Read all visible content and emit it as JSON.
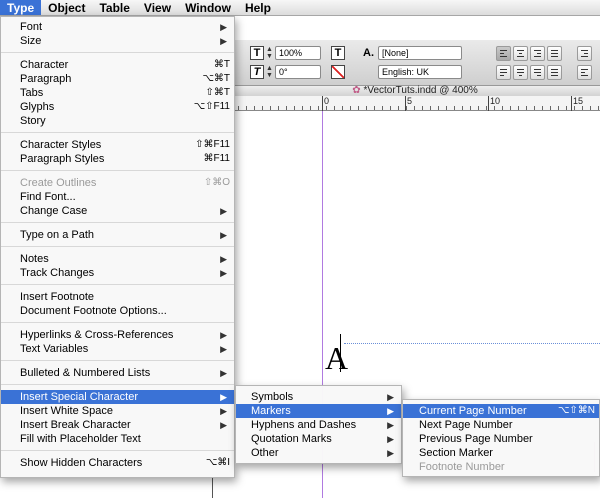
{
  "menubar": {
    "items": [
      "Type",
      "Object",
      "Table",
      "View",
      "Window",
      "Help"
    ],
    "active": "Type"
  },
  "control_panel": {
    "tracking_value": "100%",
    "skew_value": "0°",
    "char_style_value": "[None]",
    "language_value": "English: UK",
    "icon_t": "T",
    "icon_a": "A."
  },
  "document": {
    "title": "*VectorTuts.indd @ 400%",
    "ruler_numbers": [
      "0",
      "5",
      "10",
      "15"
    ],
    "text_glyph": "A"
  },
  "type_menu": {
    "groups": [
      [
        {
          "label": "Font",
          "shortcut": "",
          "submenu": true
        },
        {
          "label": "Size",
          "shortcut": "",
          "submenu": true
        }
      ],
      [
        {
          "label": "Character",
          "shortcut": "⌘T",
          "submenu": false
        },
        {
          "label": "Paragraph",
          "shortcut": "⌥⌘T",
          "submenu": false
        },
        {
          "label": "Tabs",
          "shortcut": "⇧⌘T",
          "submenu": false
        },
        {
          "label": "Glyphs",
          "shortcut": "⌥⇧F11",
          "submenu": false
        },
        {
          "label": "Story",
          "shortcut": "",
          "submenu": false
        }
      ],
      [
        {
          "label": "Character Styles",
          "shortcut": "⇧⌘F11",
          "submenu": false
        },
        {
          "label": "Paragraph Styles",
          "shortcut": "⌘F11",
          "submenu": false
        }
      ],
      [
        {
          "label": "Create Outlines",
          "shortcut": "⇧⌘O",
          "submenu": false,
          "disabled": true
        },
        {
          "label": "Find Font...",
          "shortcut": "",
          "submenu": false
        },
        {
          "label": "Change Case",
          "shortcut": "",
          "submenu": true
        }
      ],
      [
        {
          "label": "Type on a Path",
          "shortcut": "",
          "submenu": true
        }
      ],
      [
        {
          "label": "Notes",
          "shortcut": "",
          "submenu": true
        },
        {
          "label": "Track Changes",
          "shortcut": "",
          "submenu": true
        }
      ],
      [
        {
          "label": "Insert Footnote",
          "shortcut": "",
          "submenu": false
        },
        {
          "label": "Document Footnote Options...",
          "shortcut": "",
          "submenu": false
        }
      ],
      [
        {
          "label": "Hyperlinks & Cross-References",
          "shortcut": "",
          "submenu": true
        },
        {
          "label": "Text Variables",
          "shortcut": "",
          "submenu": true
        }
      ],
      [
        {
          "label": "Bulleted & Numbered Lists",
          "shortcut": "",
          "submenu": true
        }
      ],
      [
        {
          "label": "Insert Special Character",
          "shortcut": "",
          "submenu": true,
          "highlighted": true
        },
        {
          "label": "Insert White Space",
          "shortcut": "",
          "submenu": true
        },
        {
          "label": "Insert Break Character",
          "shortcut": "",
          "submenu": true
        },
        {
          "label": "Fill with Placeholder Text",
          "shortcut": "",
          "submenu": false
        }
      ],
      [
        {
          "label": "Show Hidden Characters",
          "shortcut": "⌥⌘I",
          "submenu": false
        }
      ]
    ]
  },
  "special_char_menu": {
    "items": [
      {
        "label": "Symbols",
        "submenu": true
      },
      {
        "label": "Markers",
        "submenu": true,
        "highlighted": true
      },
      {
        "label": "Hyphens and Dashes",
        "submenu": true
      },
      {
        "label": "Quotation Marks",
        "submenu": true
      },
      {
        "label": "Other",
        "submenu": true
      }
    ]
  },
  "markers_menu": {
    "items": [
      {
        "label": "Current Page Number",
        "shortcut": "⌥⇧⌘N",
        "highlighted": true
      },
      {
        "label": "Next Page Number",
        "shortcut": ""
      },
      {
        "label": "Previous Page Number",
        "shortcut": ""
      },
      {
        "label": "Section Marker",
        "shortcut": ""
      },
      {
        "label": "Footnote Number",
        "shortcut": "",
        "disabled": true
      }
    ]
  },
  "colors": {
    "highlight": "#3a72d6",
    "guide": "#b07ae0",
    "menubar": "#dcdcdc"
  }
}
